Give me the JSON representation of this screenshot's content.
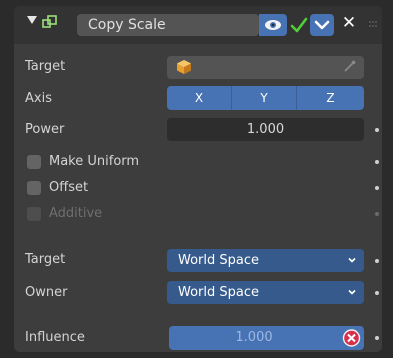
{
  "header": {
    "constraint_name": "Copy Scale",
    "collapse_icon": "disclosure-triangle-down",
    "type_icon": "copy-scale-constraint-icon",
    "visibility_icon": "eye-icon",
    "enabled_icon": "checkmark-icon",
    "menu_icon": "chevron-down-icon",
    "close_label": "✕"
  },
  "fields": {
    "target_label": "Target",
    "target_value": "",
    "axis_label": "Axis",
    "axis_buttons": [
      "X",
      "Y",
      "Z"
    ],
    "power_label": "Power",
    "power_value": "1.000",
    "make_uniform_label": "Make Uniform",
    "make_uniform_checked": false,
    "offset_label": "Offset",
    "offset_checked": false,
    "additive_label": "Additive",
    "additive_checked": false,
    "additive_enabled": false,
    "target_space_label": "Target",
    "target_space_value": "World Space",
    "owner_space_label": "Owner",
    "owner_space_value": "World Space",
    "influence_label": "Influence",
    "influence_value": "1.000"
  },
  "colors": {
    "accent_blue": "#4772b3",
    "panel_bg": "#3d3d3d",
    "field_dark": "#2d2d2d",
    "check_green": "#4fcf3a",
    "disable_red": "#d8304b"
  }
}
